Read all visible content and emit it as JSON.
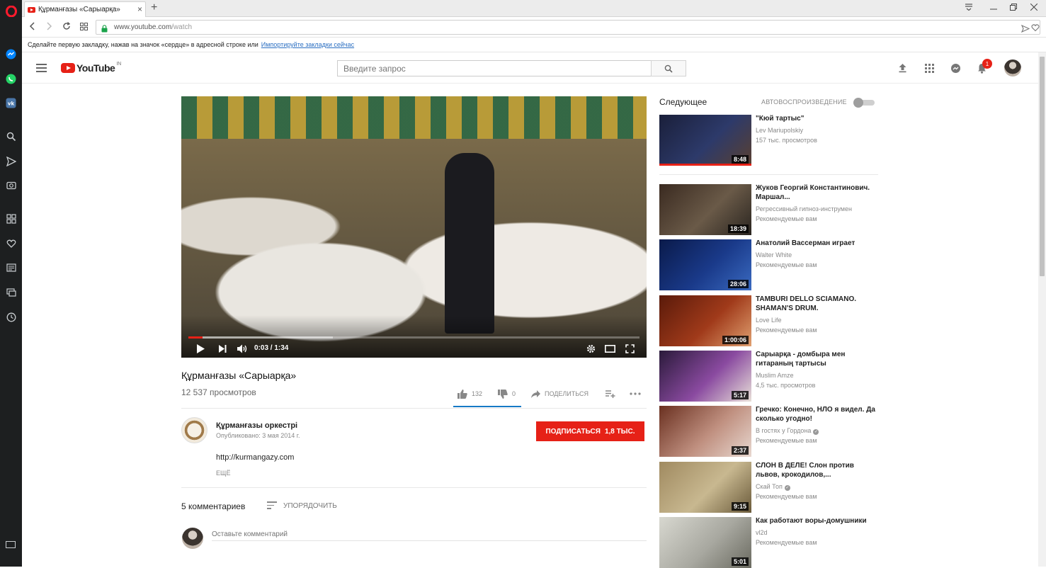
{
  "browser": {
    "tab_title": "Құрманғазы «Сарыарқа»",
    "url_host": "www.youtube.com",
    "url_path": "/watch",
    "bookmarks_hint": "Сделайте первую закладку, нажав на значок «сердце» в адресной строке или",
    "bookmarks_link": "Импортируйте закладки сейчас"
  },
  "header": {
    "logo_text": "YouTube",
    "logo_region": "IN",
    "search_placeholder": "Введите запрос",
    "notification_count": "1"
  },
  "video": {
    "title": "Құрманғазы «Сарыарқа»",
    "views": "12 537 просмотров",
    "current_time": "0:03",
    "duration": "1:34",
    "time_display": "0:03 / 1:34",
    "progress_fraction": 0.032,
    "buffer_fraction": 0.32,
    "likes": "132",
    "dislikes": "0",
    "share_label": "ПОДЕЛИТЬСЯ"
  },
  "channel": {
    "name": "Құрманғазы оркестрі",
    "published": "Опубликовано: 3 мая 2014 г.",
    "subscribe_label": "ПОДПИСАТЬСЯ",
    "subscriber_count": "1,8 ТЫС.",
    "description": "http://kurmangazy.com",
    "more_label": "ЕЩЁ"
  },
  "comments": {
    "count_label": "5 комментариев",
    "sort_label": "УПОРЯДОЧИТЬ",
    "input_placeholder": "Оставьте комментарий"
  },
  "sidebar": {
    "up_next_label": "Следующее",
    "autoplay_label": "АВТОВОСПРОИЗВЕДЕНИЕ",
    "autoplay_on": false,
    "items": [
      {
        "title": "\"Кюй тартыс\"",
        "channel": "Lev Mariupolskiy",
        "verified": false,
        "meta": "157 тыс. просмотров",
        "duration": "8:48",
        "thumb_colors": [
          "#1a1f3a",
          "#2d3a6a",
          "#5a4030"
        ],
        "watched": true
      },
      {
        "title": "Жуков Георгий Константинович. Маршал...",
        "channel": "Регрессивный гипноз-инструмен",
        "verified": false,
        "meta": "Рекомендуемые вам",
        "duration": "18:39",
        "thumb_colors": [
          "#3a2a20",
          "#6a5a48",
          "#2a2520"
        ],
        "watched": false
      },
      {
        "title": "Анатолий Вассерман играет",
        "channel": "Walter White",
        "verified": false,
        "meta": "Рекомендуемые вам",
        "duration": "28:06",
        "thumb_colors": [
          "#0a1a4a",
          "#1a3a8a",
          "#3a6ac0"
        ],
        "watched": false
      },
      {
        "title": "TAMBURI DELLO SCIAMANO. SHAMAN'S DRUM.",
        "channel": "Love Life",
        "verified": false,
        "meta": "Рекомендуемые вам",
        "duration": "1:00:06",
        "thumb_colors": [
          "#5a1a0a",
          "#a03a1a",
          "#e0a070"
        ],
        "watched": false
      },
      {
        "title": "Сарыарқа - домбыра мен гитараның тартысы",
        "channel": "Muslim Amze",
        "verified": false,
        "meta": "4,5 тыс. просмотров",
        "duration": "5:17",
        "thumb_colors": [
          "#2a1a3a",
          "#8a4aa0",
          "#e8e0d8"
        ],
        "watched": false
      },
      {
        "title": "Гречко: Конечно, НЛО я видел. Да сколько угодно!",
        "channel": "В гостях у Гордона",
        "verified": true,
        "meta": "Рекомендуемые вам",
        "duration": "2:37",
        "thumb_colors": [
          "#6a3020",
          "#c09080",
          "#e8d8d0"
        ],
        "watched": false
      },
      {
        "title": "СЛОН В ДЕЛЕ! Слон против львов, крокодилов,...",
        "channel": "Скай Топ",
        "verified": true,
        "meta": "Рекомендуемые вам",
        "duration": "9:15",
        "thumb_colors": [
          "#a08a60",
          "#c8b890",
          "#6a5a3a"
        ],
        "watched": false
      },
      {
        "title": "Как работают воры-домушники",
        "channel": "vl2d",
        "verified": false,
        "meta": "Рекомендуемые вам",
        "duration": "5:01",
        "thumb_colors": [
          "#d8d8d0",
          "#a8a8a0",
          "#6a6a60"
        ],
        "watched": false
      }
    ]
  },
  "colors": {
    "accent": "#e62117",
    "link": "#167ac6",
    "opera_sidebar": "#1d1f20"
  }
}
